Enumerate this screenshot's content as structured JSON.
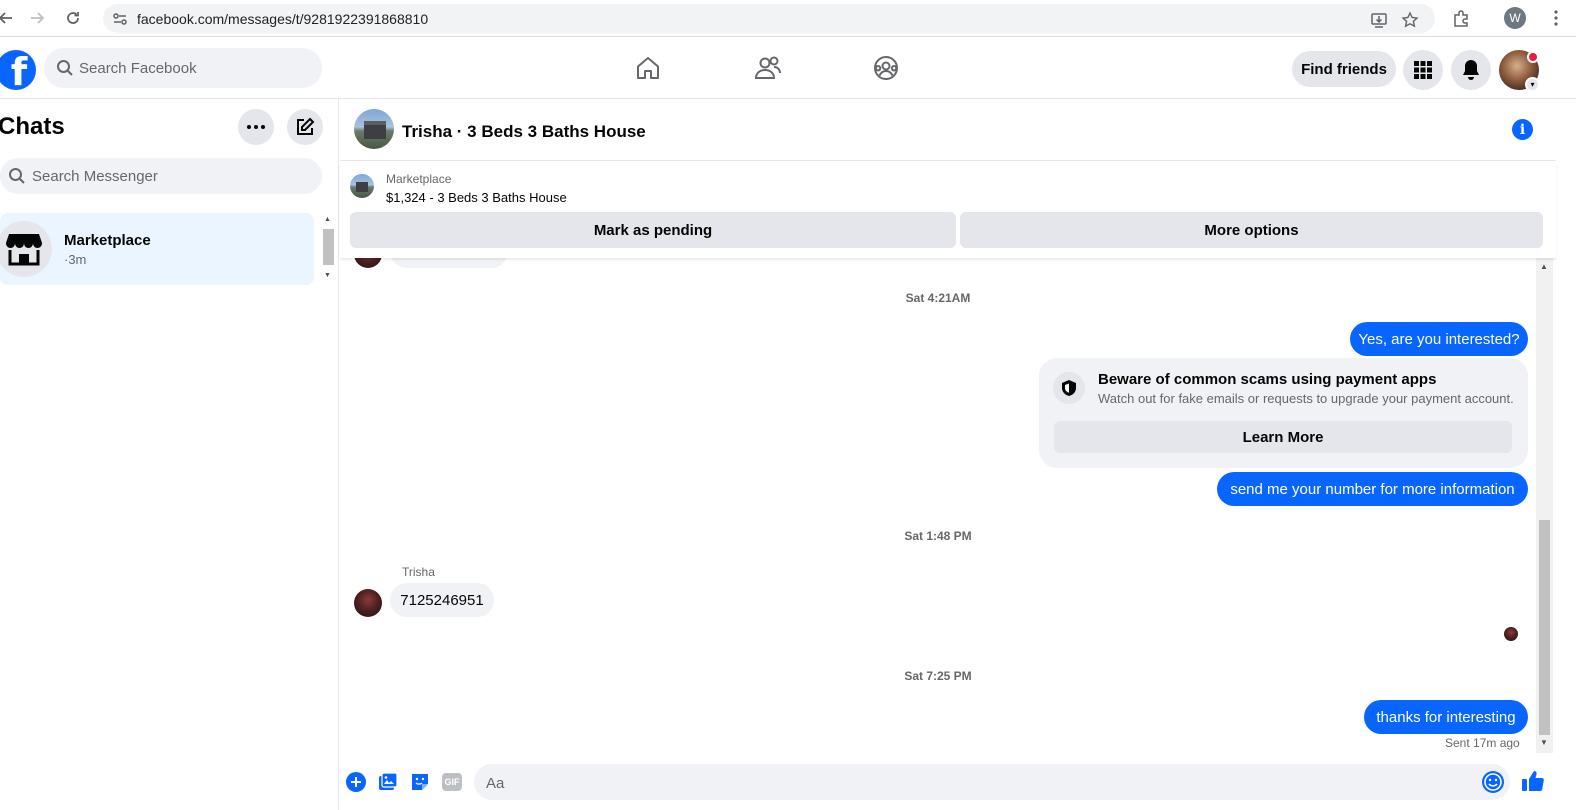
{
  "browser": {
    "url": "facebook.com/messages/t/9281922391868810",
    "profile_initial": "W"
  },
  "header": {
    "search_placeholder": "Search Facebook",
    "find_friends": "Find friends"
  },
  "sidebar": {
    "title": "Chats",
    "search_placeholder": "Search Messenger",
    "chats": [
      {
        "name": "Marketplace",
        "time": "·3m"
      }
    ]
  },
  "conversation": {
    "title": "Trisha · 3 Beds 3 Baths House",
    "listing_source": "Marketplace",
    "listing_desc": "$1,324 - 3 Beds 3 Baths House",
    "mark_pending": "Mark as pending",
    "more_options": "More options"
  },
  "messages": {
    "ts1": "Sat 4:21AM",
    "out1": "Yes, are you interested?",
    "scam_title": "Beware of common scams using payment apps",
    "scam_sub": "Watch out for fake emails or requests to upgrade your payment account.",
    "learn_more": "Learn More",
    "out2": "send me your number for more information",
    "ts2": "Sat 1:48 PM",
    "peer_name": "Trisha",
    "in1": "7125246951",
    "ts3": "Sat 7:25 PM",
    "out3": "thanks for interesting",
    "sent_status": "Sent 17m ago"
  },
  "composer": {
    "placeholder": "Aa",
    "gif_label": "GIF"
  },
  "colors": {
    "brand_blue": "#0866ff",
    "bubble_in": "#f0f2f5",
    "active_chat": "#ebf5ff",
    "notification_red": "#e41e3f"
  }
}
